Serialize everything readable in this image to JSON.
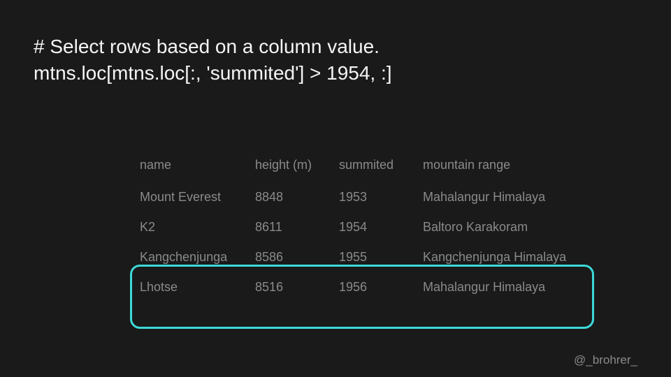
{
  "code": {
    "line1": "# Select rows based on a column value.",
    "line2": "mtns.loc[mtns.loc[:, 'summited'] > 1954, :]"
  },
  "table": {
    "headers": {
      "name": "name",
      "height": "height (m)",
      "summited": "summited",
      "range": "mountain range"
    },
    "rows": [
      {
        "name": "Mount Everest",
        "height": "8848",
        "summited": "1953",
        "range": "Mahalangur Himalaya"
      },
      {
        "name": "K2",
        "height": "8611",
        "summited": "1954",
        "range": "Baltoro Karakoram"
      },
      {
        "name": "Kangchenjunga",
        "height": "8586",
        "summited": "1955",
        "range": "Kangchenjunga Himalaya"
      },
      {
        "name": "Lhotse",
        "height": "8516",
        "summited": "1956",
        "range": "Mahalangur Himalaya"
      }
    ]
  },
  "attribution": "@_brohrer_",
  "highlight_color": "#3dd9d9"
}
